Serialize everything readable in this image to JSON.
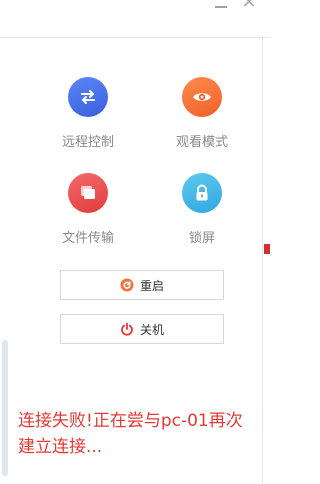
{
  "window": {
    "close_glyph": "×"
  },
  "actions": [
    {
      "label": "远程控制",
      "icon": "swap-arrows-icon"
    },
    {
      "label": "观看模式",
      "icon": "eye-icon"
    },
    {
      "label": "文件传输",
      "icon": "files-icon"
    },
    {
      "label": "锁屏",
      "icon": "lock-icon"
    }
  ],
  "buttons": {
    "restart": "重启",
    "shutdown": "关机"
  },
  "status_message": "连接失败!正在尝与pc-01再次建立连接...",
  "colors": {
    "remote": "#4a72ee",
    "watch": "#f5733a",
    "file": "#ea4b4b",
    "lock": "#44b8e8",
    "error": "#e53935"
  }
}
